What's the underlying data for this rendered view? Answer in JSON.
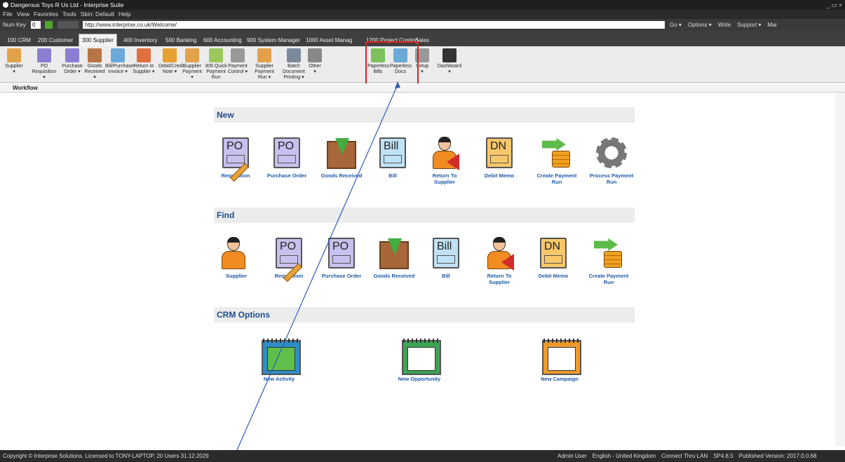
{
  "window": {
    "title": "Dangerous Toys R Us Ltd - Interprise Suite",
    "controls": "_ ▭ ×"
  },
  "menubar": [
    "File",
    "View",
    "Favorites",
    "Tools",
    "Skin: Default",
    "Help"
  ],
  "addressbar": {
    "numkey_label": "Num Key",
    "numkey_value": "0",
    "url": "http://www.interprise.co.uk/Welcome/",
    "right_tools": [
      "Go ▾",
      "Options ▾",
      "Write",
      "Support ▾",
      "Mai"
    ]
  },
  "tabs": [
    "100 CRM",
    "200 Customer",
    "300 Supplier",
    "400 Inventory",
    "500 Banking",
    "600 Accounting",
    "900 System Manager",
    "1000 Asset Manag",
    "1200 Project Costing",
    "Sales"
  ],
  "active_tab": "300 Supplier",
  "ribbon": [
    {
      "label": "Supplier",
      "sub": "▾",
      "color": "#e3a24a"
    },
    {
      "label": "PO Requisition",
      "sub": "▾",
      "color": "#8a7fd3"
    },
    {
      "label": "Purchase",
      "sub": "Order ▾",
      "color": "#8a7fd3"
    },
    {
      "label": "Goods",
      "sub": "Received ▾",
      "color": "#b77545"
    },
    {
      "label": "Bill/Purchase",
      "sub": "Invoice ▾",
      "color": "#6aa9d8"
    },
    {
      "label": "Return to",
      "sub": "Supplier ▾",
      "color": "#e07040"
    },
    {
      "label": "Debit/Credit",
      "sub": "Note ▾",
      "color": "#e8a030"
    },
    {
      "label": "Supplier",
      "sub": "Payment ▾",
      "color": "#e3a24a"
    },
    {
      "label": "309 Quick",
      "sub": "Payment Run",
      "color": "#9bc85a"
    },
    {
      "label": "Payment",
      "sub": "Control ▾",
      "color": "#999999"
    },
    {
      "label": "Supplier",
      "sub": "Payment Run ▾",
      "color": "#e3a24a"
    },
    {
      "label": "Batch Document",
      "sub": "Printing ▾",
      "color": "#7a8a9a"
    },
    {
      "label": "Other",
      "sub": "▾",
      "color": "#888888"
    },
    {
      "label": "Paperless",
      "sub": "Bills",
      "color": "#7cc25a"
    },
    {
      "label": "Paperless",
      "sub": "Docs",
      "color": "#6aa9d8"
    },
    {
      "label": "Setup",
      "sub": "▾",
      "color": "#999999"
    },
    {
      "label": "Dashboard",
      "sub": "▾",
      "color": "#333333"
    }
  ],
  "workflow_label": "Workflow",
  "sections": {
    "new": {
      "title": "New",
      "items": [
        {
          "icon": "po-requisition-icon",
          "label": "Requisition",
          "glyph": "PO"
        },
        {
          "icon": "purchase-order-icon",
          "label": "Purchase Order",
          "glyph": "PO"
        },
        {
          "icon": "goods-received-icon",
          "label": "Goods Received",
          "glyph": ""
        },
        {
          "icon": "bill-icon",
          "label": "Bill",
          "glyph": "Bill"
        },
        {
          "icon": "return-to-supplier-icon",
          "label": "Return To Supplier",
          "glyph": ""
        },
        {
          "icon": "debit-memo-icon",
          "label": "Debit Memo",
          "glyph": "DN"
        },
        {
          "icon": "create-payment-run-icon",
          "label": "Create Payment Run",
          "glyph": ""
        },
        {
          "icon": "process-payment-run-icon",
          "label": "Process Payment Run",
          "glyph": ""
        }
      ]
    },
    "find": {
      "title": "Find",
      "items": [
        {
          "icon": "supplier-icon",
          "label": "Supplier",
          "glyph": ""
        },
        {
          "icon": "po-requisition-icon",
          "label": "Requisition",
          "glyph": "PO"
        },
        {
          "icon": "purchase-order-icon",
          "label": "Purchase Order",
          "glyph": "PO"
        },
        {
          "icon": "goods-received-icon",
          "label": "Goods Received",
          "glyph": ""
        },
        {
          "icon": "bill-icon",
          "label": "Bill",
          "glyph": "Bill"
        },
        {
          "icon": "return-to-supplier-icon",
          "label": "Return To Supplier",
          "glyph": ""
        },
        {
          "icon": "debit-memo-icon",
          "label": "Debit Memo",
          "glyph": "DN"
        },
        {
          "icon": "create-payment-run-icon",
          "label": "Create Payment Run",
          "glyph": ""
        }
      ]
    },
    "crm": {
      "title": "CRM Options",
      "items": [
        {
          "icon": "new-activity-icon",
          "label": "New Activity",
          "color": "#2d8fc6"
        },
        {
          "icon": "new-opportunity-icon",
          "label": "New Opportunity",
          "color": "#3aa552"
        },
        {
          "icon": "new-campaign-icon",
          "label": "New Campaign",
          "color": "#ee9a2a"
        }
      ]
    }
  },
  "statusbar": {
    "copyright": "Copyright © Interprise Solutions. Licensed to TONY-LAPTOP, 20 Users 31.12.2029",
    "right": [
      "Admin User",
      "English - United Kingdom",
      "Connect Thru LAN",
      "SP4.8.5",
      "Published Version: 2017.0.0.68"
    ]
  },
  "colors": {
    "highlight": "#e0201b",
    "annotation_line": "#2f5fb5",
    "label_blue": "#1e5aa8"
  }
}
